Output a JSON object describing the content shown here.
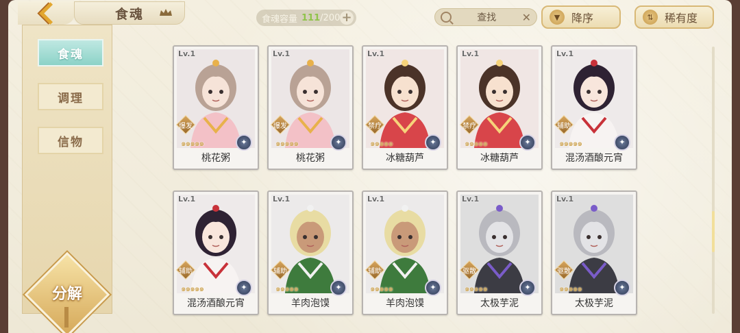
{
  "header": {
    "title": "食魂",
    "capacity_label": "食魂容量",
    "capacity_current": "111",
    "capacity_sep": "/",
    "capacity_max": "200",
    "search_text": "查找",
    "sort_desc_label": "降序",
    "sort_rarity_label": "稀有度"
  },
  "sidebar": {
    "tabs": [
      {
        "label": "食魂",
        "active": true
      },
      {
        "label": "调理",
        "active": false
      },
      {
        "label": "信物",
        "active": false
      }
    ],
    "decompose_label": "分解"
  },
  "cards": [
    {
      "level": "Lv.1",
      "role": "爆发",
      "name": "桃花粥",
      "palette": "peach"
    },
    {
      "level": "Lv.1",
      "role": "爆发",
      "name": "桃花粥",
      "palette": "peach"
    },
    {
      "level": "Lv.1",
      "role": "禁疗",
      "name": "冰糖葫芦",
      "palette": "red"
    },
    {
      "level": "Lv.1",
      "role": "禁疗",
      "name": "冰糖葫芦",
      "palette": "red"
    },
    {
      "level": "Lv.1",
      "role": "辅助",
      "name": "混汤酒酿元宵",
      "palette": "white"
    },
    {
      "level": "Lv.1",
      "role": "辅助",
      "name": "混汤酒酿元宵",
      "palette": "white"
    },
    {
      "level": "Lv.1",
      "role": "辅助",
      "name": "羊肉泡馍",
      "palette": "green"
    },
    {
      "level": "Lv.1",
      "role": "辅助",
      "name": "羊肉泡馍",
      "palette": "green"
    },
    {
      "level": "Lv.1",
      "role": "驱散",
      "name": "太极芋泥",
      "palette": "gray"
    },
    {
      "level": "Lv.1",
      "role": "驱散",
      "name": "太极芋泥",
      "palette": "gray"
    }
  ],
  "card_stars": "๑๑๑๑๑",
  "colors": {
    "accent_teal": "#8cd2c7",
    "gold": "#d6a95a",
    "background": "#f1ecdc"
  }
}
